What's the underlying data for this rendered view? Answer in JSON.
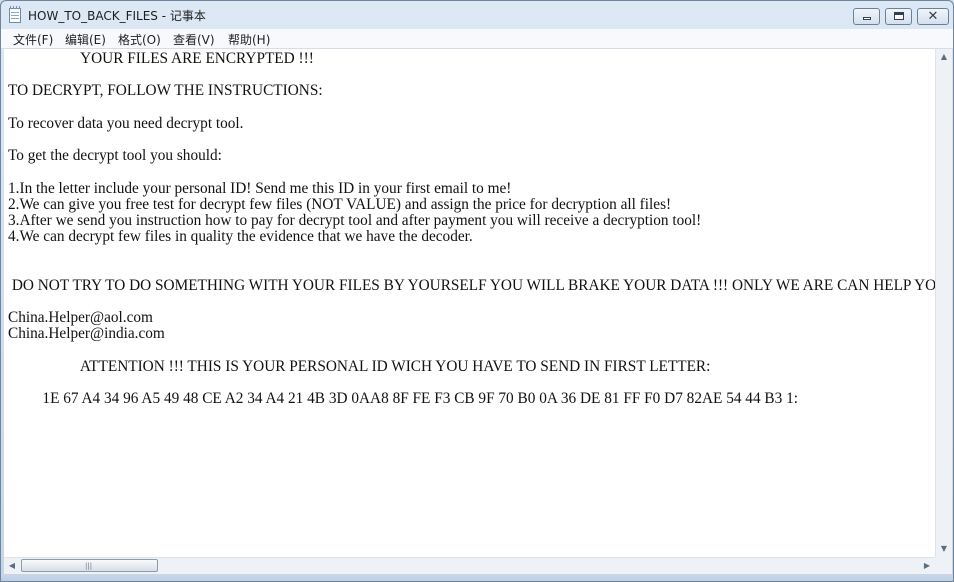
{
  "window": {
    "title": "HOW_TO_BACK_FILES - 记事本",
    "controls": {
      "minimize": "",
      "maximize": "",
      "close": "✕"
    }
  },
  "menu": {
    "file": "文件(F)",
    "edit": "编辑(E)",
    "format": "格式(O)",
    "view": "查看(V)",
    "help": "帮助(H)"
  },
  "document": {
    "text": "                   YOUR FILES ARE ENCRYPTED !!!\n\nTO DECRYPT, FOLLOW THE INSTRUCTIONS:\n\nTo recover data you need decrypt tool.\n\nTo get the decrypt tool you should:\n\n1.In the letter include your personal ID! Send me this ID in your first email to me!\n2.We can give you free test for decrypt few files (NOT VALUE) and assign the price for decryption all files!\n3.After we send you instruction how to pay for decrypt tool and after payment you will receive a decryption tool!\n4.We can decrypt few files in quality the evidence that we have the decoder.\n\n\n DO NOT TRY TO DO SOMETHING WITH YOUR FILES BY YOURSELF YOU WILL BRAKE YOUR DATA !!! ONLY WE ARE CAN HELP YOU! CONTA\n\nChina.Helper@aol.com\nChina.Helper@india.com\n\n                   ATTENTION !!! THIS IS YOUR PERSONAL ID WICH YOU HAVE TO SEND IN FIRST LETTER:\n\n         1E 67 A4 34 96 A5 49 48 CE A2 34 A4 21 4B 3D 0AA8 8F FE F3 CB 9F 70 B0 0A 36 DE 81 FF F0 D7 82AE 54 44 B3 1:"
  },
  "scrollbars": {
    "up_arrow": "▲",
    "down_arrow": "▼",
    "left_arrow": "◀",
    "right_arrow": "▶",
    "grip": "|||"
  }
}
